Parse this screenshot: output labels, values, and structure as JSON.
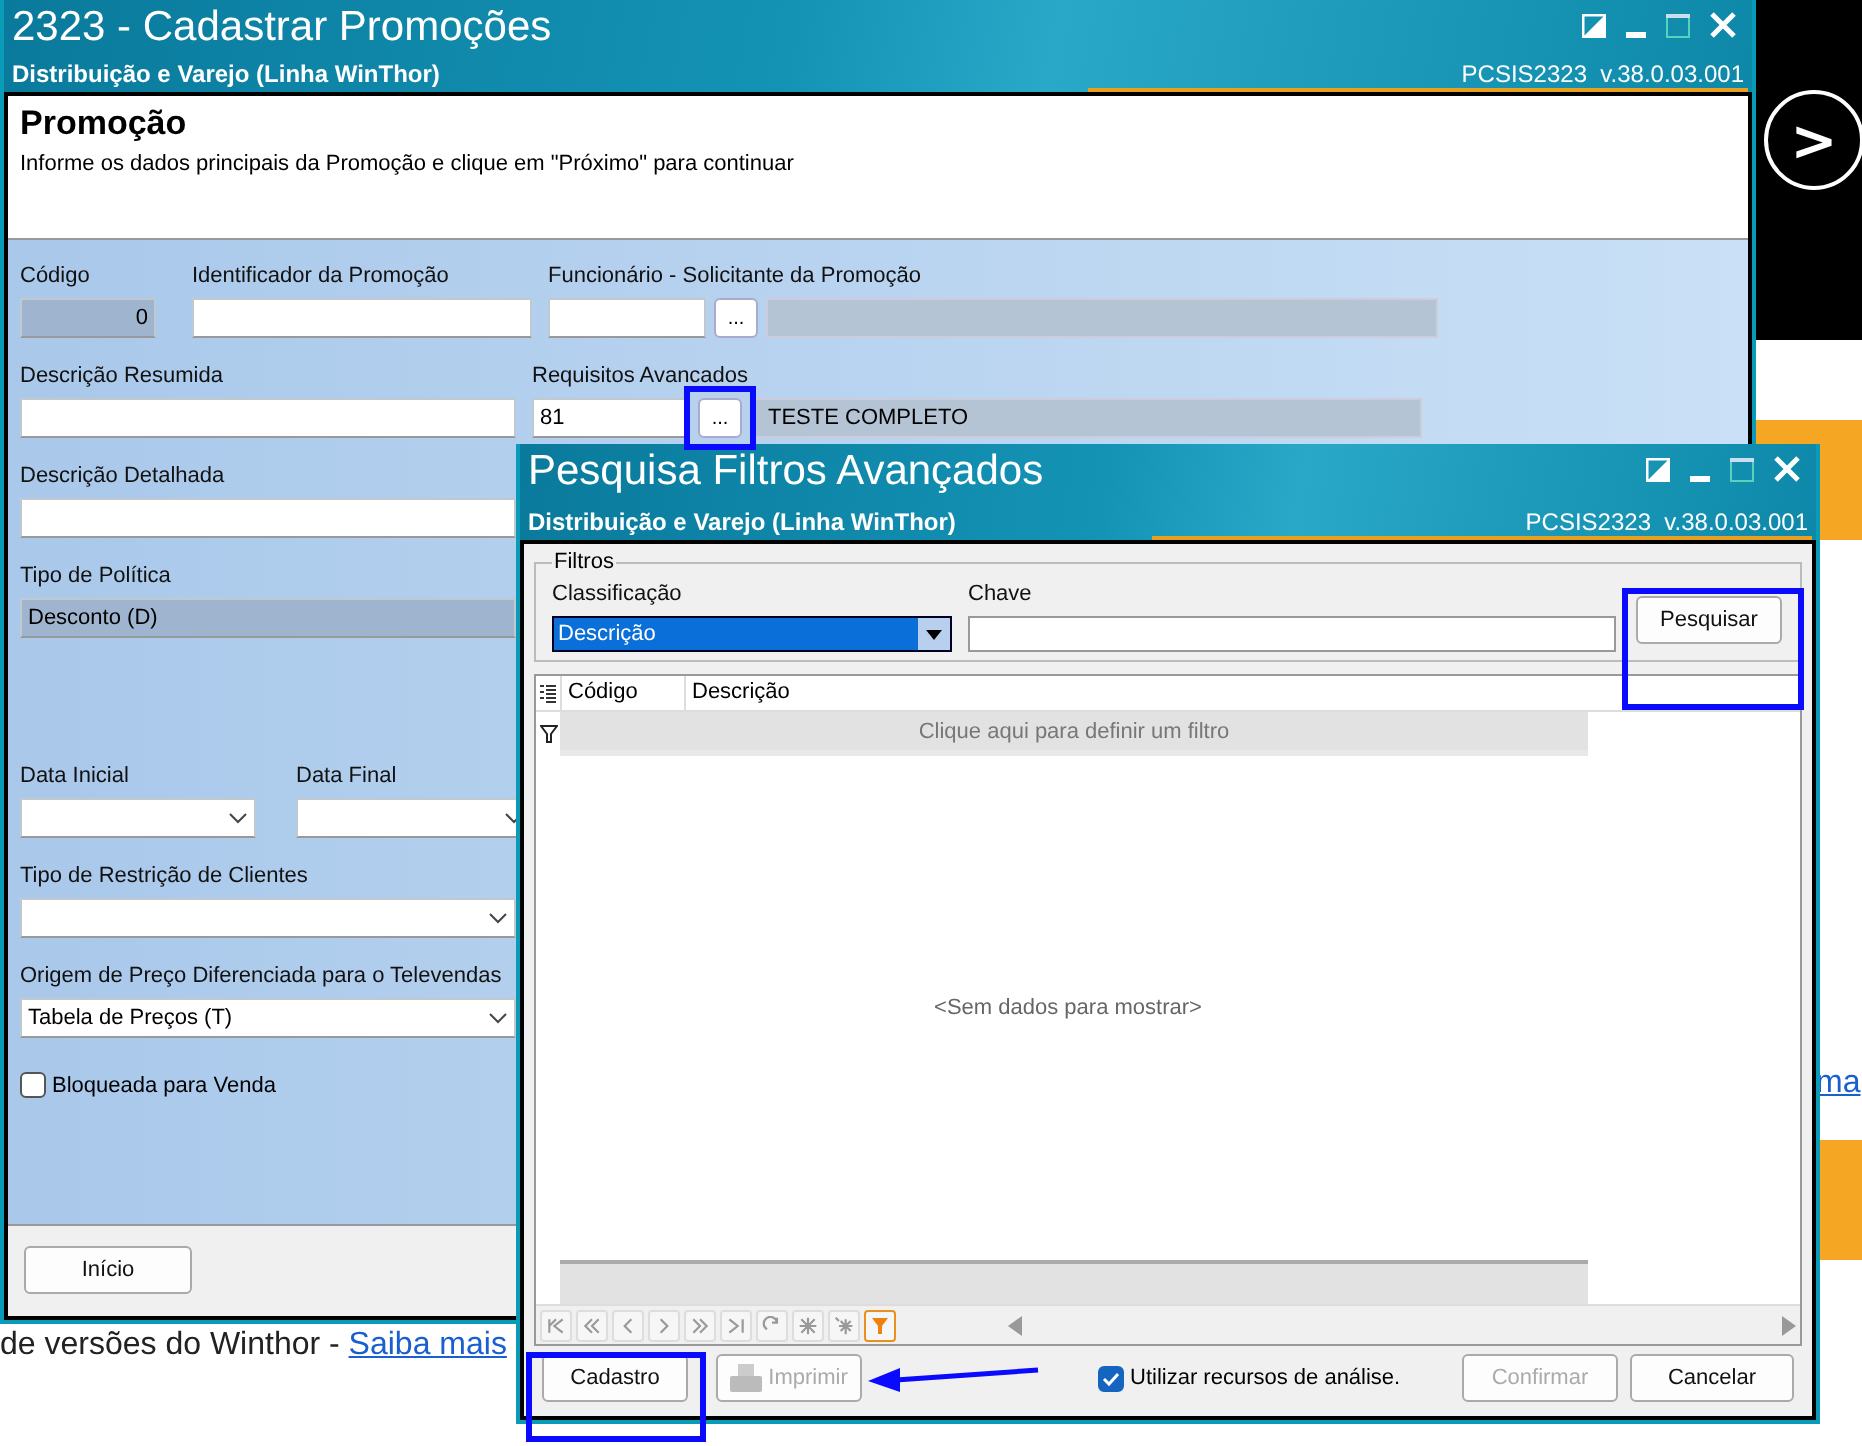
{
  "background_page": {
    "next_button": ">",
    "footer_text": "de versões do Winthor - ",
    "footer_link": "Saiba mais",
    "side_link": "ma"
  },
  "main_window": {
    "title": "2323 - Cadastrar Promoções",
    "subtitle": "Distribuição e Varejo (Linha WinThor)",
    "version": "PCSIS2323  v.38.0.03.001",
    "header": {
      "title": "Promoção",
      "instruction": "Informe os dados principais da Promoção e clique em \"Próximo\" para continuar"
    },
    "codigo": {
      "label": "Código",
      "value": "0"
    },
    "identificador": {
      "label": "Identificador da Promoção"
    },
    "funcionario": {
      "label": "Funcionário - Solicitante da Promoção",
      "lookup": "..."
    },
    "descricao_resumida": {
      "label": "Descrição Resumida"
    },
    "requisitos": {
      "label": "Requisitos Avancados",
      "value": "81",
      "lookup": "...",
      "description": "TESTE COMPLETO"
    },
    "descricao_detalhada": {
      "label": "Descrição Detalhada"
    },
    "tipo_politica": {
      "label": "Tipo de Política",
      "value": "Desconto (D)"
    },
    "data_inicial": {
      "label": "Data Inicial"
    },
    "data_final": {
      "label": "Data Final"
    },
    "restricao": {
      "label": "Tipo de Restrição de Clientes"
    },
    "origem_preco": {
      "label": "Origem de Preço Diferenciada para o Televendas",
      "value": "Tabela de Preços (T)"
    },
    "bloqueada": {
      "label": "Bloqueada para Venda",
      "checked": false
    },
    "footer_button": "Início"
  },
  "dialog": {
    "title": "Pesquisa Filtros Avançados",
    "subtitle": "Distribuição e Varejo (Linha WinThor)",
    "version": "PCSIS2323  v.38.0.03.001",
    "group": "Filtros",
    "classificacao": {
      "label": "Classificação",
      "value": "Descrição"
    },
    "chave": {
      "label": "Chave"
    },
    "search_button": "Pesquisar",
    "columns": [
      "Código",
      "Descrição"
    ],
    "filter_row": "Clique aqui para definir um filtro",
    "empty_text": "<Sem dados para mostrar>",
    "buttons": [
      {
        "label": "Cadastro",
        "disabled": false
      },
      {
        "label": "Imprimir",
        "disabled": true
      }
    ],
    "analysis": {
      "label": "Utilizar recursos de análise.",
      "checked": true
    },
    "actions": [
      {
        "label": "Confirmar",
        "disabled": true
      },
      {
        "label": "Cancelar",
        "disabled": false
      }
    ]
  }
}
